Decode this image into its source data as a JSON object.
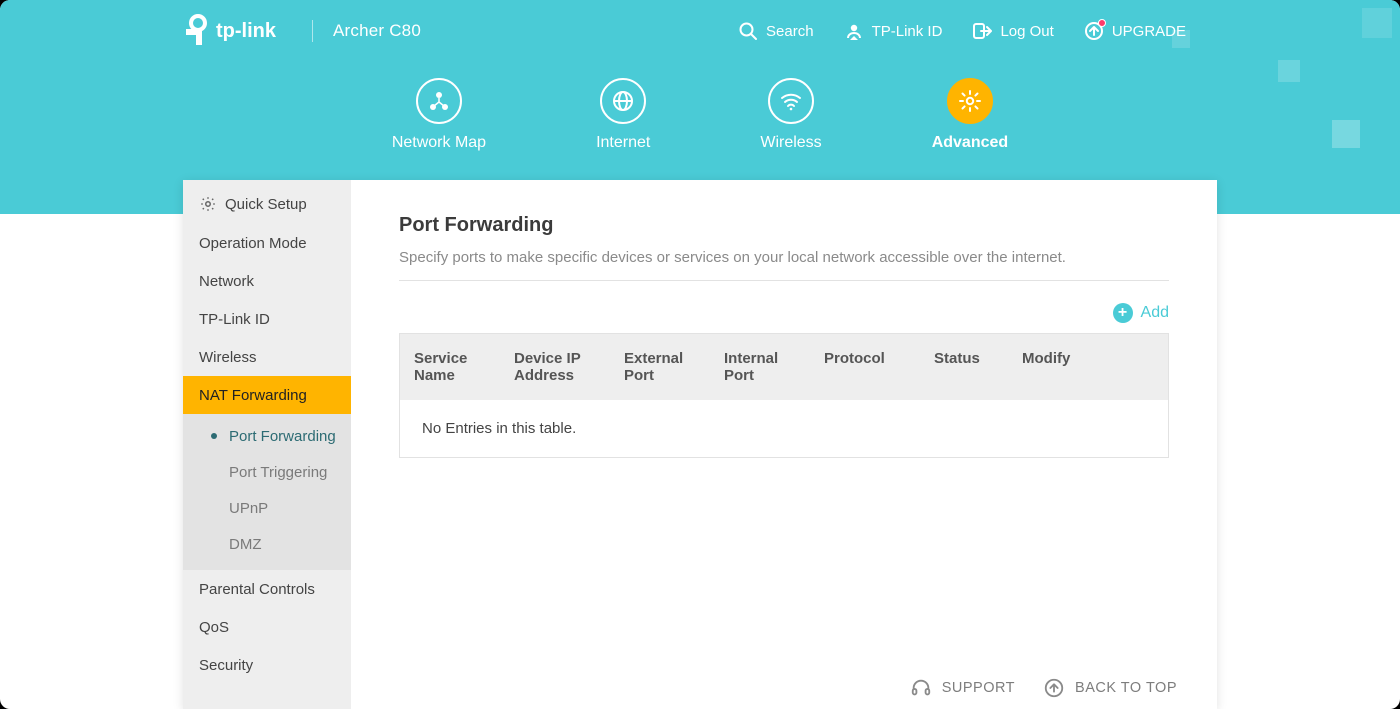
{
  "brand": {
    "name": "tp-link",
    "model": "Archer C80"
  },
  "toolbar": {
    "search": "Search",
    "tplink_id": "TP-Link ID",
    "logout": "Log Out",
    "upgrade": "UPGRADE"
  },
  "nav": {
    "items": [
      {
        "label": "Network Map",
        "icon": "network-map-icon"
      },
      {
        "label": "Internet",
        "icon": "globe-icon"
      },
      {
        "label": "Wireless",
        "icon": "wifi-icon"
      },
      {
        "label": "Advanced",
        "icon": "gear-icon"
      }
    ],
    "active_index": 3
  },
  "sidebar": {
    "items": [
      {
        "label": "Quick Setup",
        "icon": true
      },
      {
        "label": "Operation Mode"
      },
      {
        "label": "Network"
      },
      {
        "label": "TP-Link ID"
      },
      {
        "label": "Wireless"
      },
      {
        "label": "NAT Forwarding",
        "selected": true
      },
      {
        "label": "Parental Controls"
      },
      {
        "label": "QoS"
      },
      {
        "label": "Security"
      }
    ],
    "sub_items": [
      {
        "label": "Port Forwarding",
        "active": true
      },
      {
        "label": "Port Triggering"
      },
      {
        "label": "UPnP"
      },
      {
        "label": "DMZ"
      }
    ]
  },
  "content": {
    "title": "Port Forwarding",
    "description": "Specify ports to make specific devices or services on your local network accessible over the internet.",
    "add_label": "Add",
    "columns": [
      "Service Name",
      "Device IP Address",
      "External Port",
      "Internal Port",
      "Protocol",
      "Status",
      "Modify"
    ],
    "rows": [],
    "empty_text": "No Entries in this table."
  },
  "footer": {
    "support": "SUPPORT",
    "back_to_top": "BACK TO TOP"
  }
}
